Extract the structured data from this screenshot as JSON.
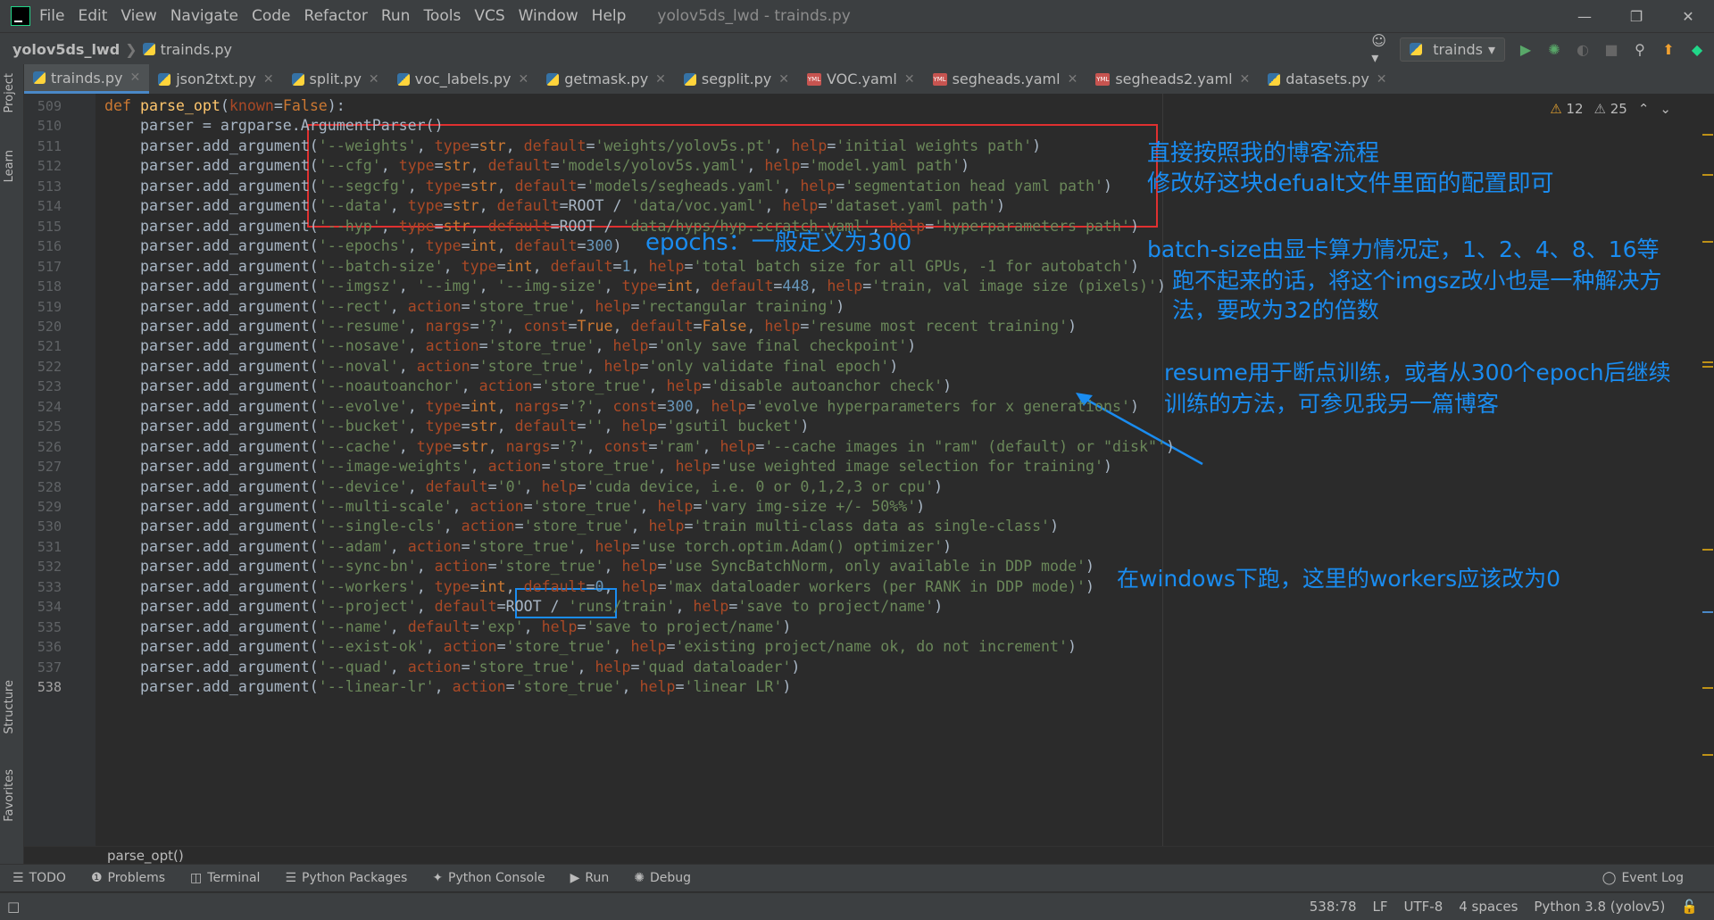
{
  "menubar": {
    "items": [
      "File",
      "Edit",
      "View",
      "Navigate",
      "Code",
      "Refactor",
      "Run",
      "Tools",
      "VCS",
      "Window",
      "Help"
    ],
    "title": "yolov5ds_lwd - trainds.py"
  },
  "navbar": {
    "project": "yolov5ds_lwd",
    "file": "trainds.py",
    "run_config": "trainds"
  },
  "tabs": [
    {
      "label": "trainds.py",
      "type": "py",
      "active": true
    },
    {
      "label": "json2txt.py",
      "type": "py"
    },
    {
      "label": "split.py",
      "type": "py"
    },
    {
      "label": "voc_labels.py",
      "type": "py"
    },
    {
      "label": "getmask.py",
      "type": "py"
    },
    {
      "label": "segplit.py",
      "type": "py"
    },
    {
      "label": "VOC.yaml",
      "type": "yaml"
    },
    {
      "label": "segheads.yaml",
      "type": "yaml"
    },
    {
      "label": "segheads2.yaml",
      "type": "yaml"
    },
    {
      "label": "datasets.py",
      "type": "py"
    }
  ],
  "left_strip": {
    "project": "Project",
    "learn": "Learn",
    "structure": "Structure",
    "favorites": "Favorites"
  },
  "inspections": {
    "warnings": "12",
    "weak_warnings": "25"
  },
  "code_lines": [
    {
      "n": "509",
      "html": "<span class='kw'>def </span><span class='fn'>parse_opt</span>(<span class='prm'>known</span>=<span class='kw'>False</span>):"
    },
    {
      "n": "510",
      "html": "    parser = argparse.ArgumentParser()"
    },
    {
      "n": "511",
      "html": "    parser.add_argument(<span class='str'>'--weights'</span>, <span class='prm'>type</span>=<span class='kw'>str</span>, <span class='prm'>default</span>=<span class='str'>'weights/yolov5s.pt'</span>, <span class='prm'>help</span>=<span class='str'>'initial weights path'</span>)"
    },
    {
      "n": "512",
      "html": "    parser.add_argument(<span class='str'>'--cfg'</span>, <span class='prm'>type</span>=<span class='kw'>str</span>, <span class='prm'>default</span>=<span class='str'>'models/yolov5s.yaml'</span>, <span class='prm'>help</span>=<span class='str'>'model.yaml path'</span>)"
    },
    {
      "n": "513",
      "html": "    parser.add_argument(<span class='str'>'--segcfg'</span>, <span class='prm'>type</span>=<span class='kw'>str</span>, <span class='prm'>default</span>=<span class='str'>'models/segheads.yaml'</span>, <span class='prm'>help</span>=<span class='str'>'segmentation head yaml path'</span>)"
    },
    {
      "n": "514",
      "html": "    parser.add_argument(<span class='str'>'--data'</span>, <span class='prm'>type</span>=<span class='kw'>str</span>, <span class='prm'>default</span>=ROOT / <span class='str'>'data/voc.yaml'</span>, <span class='prm'>help</span>=<span class='str'>'dataset.yaml path'</span>)"
    },
    {
      "n": "515",
      "html": "    parser.add_argument(<span class='str'>'--hyp'</span>, <span class='prm'>type</span>=<span class='kw'>str</span>, <span class='prm'>default</span>=ROOT / <span class='str'>'data/hyps/hyp.scratch.yaml'</span>, <span class='prm'>help</span>=<span class='str'>'hyperparameters path'</span>)"
    },
    {
      "n": "516",
      "html": "    parser.add_argument(<span class='str'>'--epochs'</span>, <span class='prm'>type</span>=<span class='kw'>int</span>, <span class='prm'>default</span>=<span class='num'>300</span>)"
    },
    {
      "n": "517",
      "html": "    parser.add_argument(<span class='str'>'--batch-size'</span>, <span class='prm'>type</span>=<span class='kw'>int</span>, <span class='prm'>default</span>=<span class='num'>1</span>, <span class='prm'>help</span>=<span class='str'>'total batch size for all GPUs, -1 for autobatch'</span>)"
    },
    {
      "n": "518",
      "html": "    parser.add_argument(<span class='str'>'--imgsz'</span>, <span class='str'>'--img'</span>, <span class='str'>'--img-size'</span>, <span class='prm'>type</span>=<span class='kw'>int</span>, <span class='prm'>default</span>=<span class='num'>448</span>, <span class='prm'>help</span>=<span class='str'>'train, val image size (pixels)'</span>)"
    },
    {
      "n": "519",
      "html": "    parser.add_argument(<span class='str'>'--rect'</span>, <span class='prm'>action</span>=<span class='str'>'store_true'</span>, <span class='prm'>help</span>=<span class='str'>'rectangular training'</span>)"
    },
    {
      "n": "520",
      "html": "    parser.add_argument(<span class='str'>'--resume'</span>, <span class='prm'>nargs</span>=<span class='str'>'?'</span>, <span class='prm'>const</span>=<span class='kw'>True</span>, <span class='prm'>default</span>=<span class='kw'>False</span>, <span class='prm'>help</span>=<span class='str'>'resume most recent training'</span>)"
    },
    {
      "n": "521",
      "html": "    parser.add_argument(<span class='str'>'--nosave'</span>, <span class='prm'>action</span>=<span class='str'>'store_true'</span>, <span class='prm'>help</span>=<span class='str'>'only save final checkpoint'</span>)"
    },
    {
      "n": "522",
      "html": "    parser.add_argument(<span class='str'>'--noval'</span>, <span class='prm'>action</span>=<span class='str'>'store_true'</span>, <span class='prm'>help</span>=<span class='str'>'only validate final epoch'</span>)"
    },
    {
      "n": "523",
      "html": "    parser.add_argument(<span class='str'>'--noautoanchor'</span>, <span class='prm'>action</span>=<span class='str'>'store_true'</span>, <span class='prm'>help</span>=<span class='str'>'disable autoanchor check'</span>)"
    },
    {
      "n": "524",
      "html": "    parser.add_argument(<span class='str'>'--evolve'</span>, <span class='prm'>type</span>=<span class='kw'>int</span>, <span class='prm'>nargs</span>=<span class='str'>'?'</span>, <span class='prm'>const</span>=<span class='num'>300</span>, <span class='prm'>help</span>=<span class='str'>'evolve hyperparameters for x generations'</span>)"
    },
    {
      "n": "525",
      "html": "    parser.add_argument(<span class='str'>'--bucket'</span>, <span class='prm'>type</span>=<span class='kw'>str</span>, <span class='prm'>default</span>=<span class='str'>''</span>, <span class='prm'>help</span>=<span class='str'>'gsutil bucket'</span>)"
    },
    {
      "n": "526",
      "html": "    parser.add_argument(<span class='str'>'--cache'</span>, <span class='prm'>type</span>=<span class='kw'>str</span>, <span class='prm'>nargs</span>=<span class='str'>'?'</span>, <span class='prm'>const</span>=<span class='str'>'ram'</span>, <span class='prm'>help</span>=<span class='str'>'--cache images in \"ram\" (default) or \"disk\"'</span>)"
    },
    {
      "n": "527",
      "html": "    parser.add_argument(<span class='str'>'--image-weights'</span>, <span class='prm'>action</span>=<span class='str'>'store_true'</span>, <span class='prm'>help</span>=<span class='str'>'use weighted image selection for training'</span>)"
    },
    {
      "n": "528",
      "html": "    parser.add_argument(<span class='str'>'--device'</span>, <span class='prm'>default</span>=<span class='str'>'0'</span>, <span class='prm'>help</span>=<span class='str'>'cuda device, i.e. 0 or 0,1,2,3 or cpu'</span>)"
    },
    {
      "n": "529",
      "html": "    parser.add_argument(<span class='str'>'--multi-scale'</span>, <span class='prm'>action</span>=<span class='str'>'store_true'</span>, <span class='prm'>help</span>=<span class='str'>'vary img-size +/- 50%%'</span>)"
    },
    {
      "n": "530",
      "html": "    parser.add_argument(<span class='str'>'--single-cls'</span>, <span class='prm'>action</span>=<span class='str'>'store_true'</span>, <span class='prm'>help</span>=<span class='str'>'train multi-class data as single-class'</span>)"
    },
    {
      "n": "531",
      "html": "    parser.add_argument(<span class='str'>'--adam'</span>, <span class='prm'>action</span>=<span class='str'>'store_true'</span>, <span class='prm'>help</span>=<span class='str'>'use torch.optim.Adam() optimizer'</span>)"
    },
    {
      "n": "532",
      "html": "    parser.add_argument(<span class='str'>'--sync-bn'</span>, <span class='prm'>action</span>=<span class='str'>'store_true'</span>, <span class='prm'>help</span>=<span class='str'>'use SyncBatchNorm, only available in DDP mode'</span>)"
    },
    {
      "n": "533",
      "html": "    parser.add_argument(<span class='str'>'--workers'</span>, <span class='prm'>type</span>=<span class='kw'>int</span>, <span class='prm'>default</span>=<span class='num'>0</span>, <span class='prm'>help</span>=<span class='str'>'max dataloader workers (per RANK in DDP mode)'</span>)"
    },
    {
      "n": "534",
      "html": "    parser.add_argument(<span class='str'>'--project'</span>, <span class='prm'>default</span>=ROOT / <span class='str'>'runs/train'</span>, <span class='prm'>help</span>=<span class='str'>'save to project/name'</span>)"
    },
    {
      "n": "535",
      "html": "    parser.add_argument(<span class='str'>'--name'</span>, <span class='prm'>default</span>=<span class='str'>'exp'</span>, <span class='prm'>help</span>=<span class='str'>'save to project/name'</span>)"
    },
    {
      "n": "536",
      "html": "    parser.add_argument(<span class='str'>'--exist-ok'</span>, <span class='prm'>action</span>=<span class='str'>'store_true'</span>, <span class='prm'>help</span>=<span class='str'>'existing project/name ok, do not increment'</span>)"
    },
    {
      "n": "537",
      "html": "    parser.add_argument(<span class='str'>'--quad'</span>, <span class='prm'>action</span>=<span class='str'>'store_true'</span>, <span class='prm'>help</span>=<span class='str'>'quad dataloader'</span>)"
    },
    {
      "n": "538",
      "html": "    parser.add_argument(<span class='str'>'--linear-lr'</span>, <span class='prm'>action</span>=<span class='str'>'store_true'</span>, <span class='prm'>help</span>=<span class='str'>'linear LR'</span>)"
    }
  ],
  "annotations": {
    "a1_line1": "直接按照我的博客流程",
    "a1_line2": "修改好这块defualt文件里面的配置即可",
    "epochs": "epochs：一般定义为300",
    "batch": "batch-size由显卡算力情况定，1、2、4、8、16等",
    "imgsz_line1": "跑不起来的话，将这个imgsz改小也是一种解决方",
    "imgsz_line2": "法，要改为32的倍数",
    "resume_line1": "resume用于断点训练，或者从300个epoch后继续",
    "resume_line2": "训练的方法，可参见我另一篇博客",
    "workers": "在windows下跑，这里的workers应该改为0"
  },
  "breadcrumb_function": "parse_opt()",
  "tool_windows": [
    "TODO",
    "Problems",
    "Terminal",
    "Python Packages",
    "Python Console",
    "Run",
    "Debug"
  ],
  "event_log": "Event Log",
  "status": {
    "position": "538:78",
    "line_sep": "LF",
    "encoding": "UTF-8",
    "indent": "4 spaces",
    "interpreter": "Python 3.8 (yolov5)"
  },
  "colors": {
    "accent": "#4a88c7",
    "annotation": "#1a8cf0",
    "red_box": "#e03030"
  }
}
